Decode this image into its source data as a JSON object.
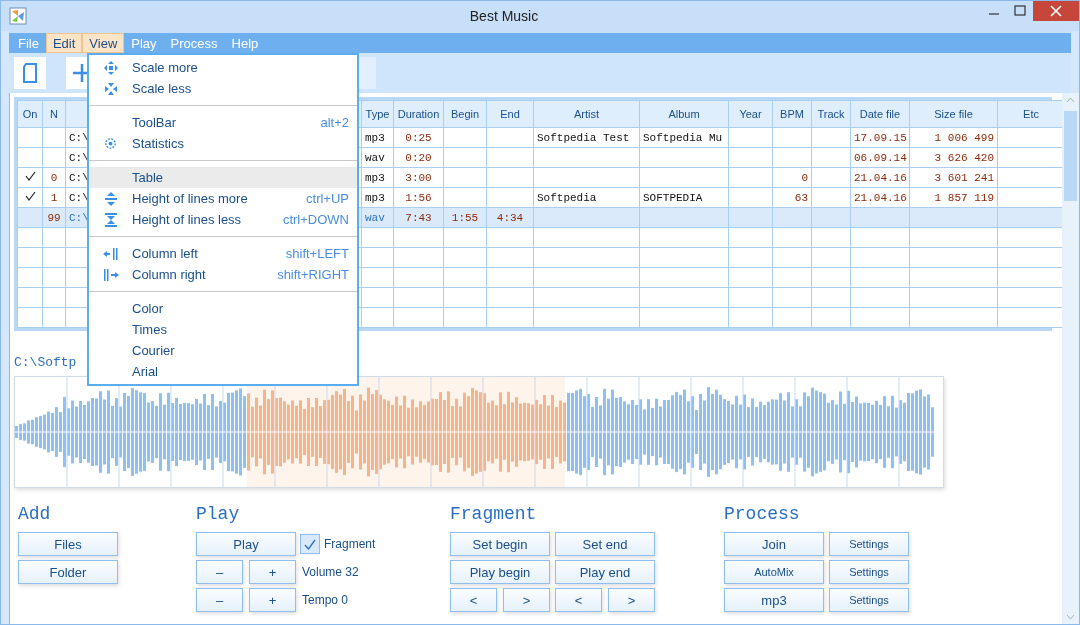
{
  "window": {
    "title": "Best Music"
  },
  "menu_bar": [
    {
      "label": "File",
      "highlighted": false
    },
    {
      "label": "Edit",
      "highlighted": true
    },
    {
      "label": "View",
      "highlighted": true
    },
    {
      "label": "Play",
      "highlighted": false
    },
    {
      "label": "Process",
      "highlighted": false
    },
    {
      "label": "Help",
      "highlighted": false
    }
  ],
  "view_menu": [
    [
      {
        "label": "Scale more",
        "selected": false
      },
      {
        "label": "Scale less",
        "selected": false
      }
    ],
    [
      {
        "label": "ToolBar",
        "shortcut": "alt+2",
        "selected": false
      },
      {
        "label": "Statistics",
        "selected": false
      }
    ],
    [
      {
        "label": "Table",
        "selected": true
      },
      {
        "label": "Height of lines more",
        "shortcut": "ctrl+UP",
        "selected": false
      },
      {
        "label": "Height of lines less",
        "shortcut": "ctrl+DOWN",
        "selected": false
      }
    ],
    [
      {
        "label": "Column left",
        "shortcut": "shift+LEFT",
        "selected": false
      },
      {
        "label": "Column right",
        "shortcut": "shift+RIGHT",
        "selected": false
      }
    ],
    [
      {
        "label": "Color",
        "selected": false
      },
      {
        "label": "Times",
        "selected": false
      },
      {
        "label": "Courier",
        "selected": false
      },
      {
        "label": "Arial",
        "selected": false
      }
    ]
  ],
  "table": {
    "columns": [
      {
        "label": "On"
      },
      {
        "label": "N"
      },
      {},
      {
        "label": "Type"
      },
      {
        "label": "Duration"
      },
      {
        "label": "Begin"
      },
      {
        "label": "End"
      },
      {
        "label": "Artist"
      },
      {
        "label": "Album"
      },
      {
        "label": "Year"
      },
      {
        "label": "BPM"
      },
      {
        "label": "Track"
      },
      {
        "label": "Date file"
      },
      {
        "label": "Size file"
      },
      {
        "label": "Etc"
      }
    ],
    "rows": [
      {
        "on": false,
        "selected": false,
        "path": "C:\\",
        "type": "mp3",
        "duration": "0:25",
        "artist": "Softpedia Test",
        "album": "Softpedia Mu",
        "date": "17.09.15",
        "size": "1 006 499"
      },
      {
        "on": false,
        "selected": false,
        "path": "C:\\",
        "type": "wav",
        "duration": "0:20",
        "date": "06.09.14",
        "size": "3 626 420"
      },
      {
        "on": true,
        "selected": false,
        "n": "0",
        "path": "C:\\",
        "type": "mp3",
        "duration": "3:00",
        "bpm": "0",
        "date": "21.04.16",
        "size": "3 601 241"
      },
      {
        "on": true,
        "selected": false,
        "n": "1",
        "path": "C:\\",
        "type": "mp3",
        "duration": "1:56",
        "artist": "Softpedia",
        "album": "SOFTPEDIA",
        "bpm": "63",
        "date": "21.04.16",
        "size": "1 857 119"
      },
      {
        "on": false,
        "selected": true,
        "n": "99",
        "path": "C:\\",
        "type": "wav",
        "duration": "7:43",
        "begin": "1:55",
        "end": "4:34"
      }
    ]
  },
  "file_path": "C:\\Softp",
  "panels": [
    {
      "title": "Add",
      "buttons": [
        "Files",
        "Folder"
      ]
    },
    {
      "title": "Play",
      "play_button": "Play",
      "fragment": {
        "label": "Fragment",
        "checked": true
      },
      "volume": "Volume 32",
      "tempo": "Tempo 0",
      "minus": "–",
      "plus": "+"
    },
    {
      "title": "Fragment",
      "buttons": [
        "Set begin",
        "Set end",
        "Play begin",
        "Play end",
        "<",
        ">",
        "<",
        ">"
      ]
    },
    {
      "title": "Process",
      "rows": [
        [
          "Join",
          "Settings"
        ],
        [
          "AutoMix",
          "Settings"
        ],
        [
          "mp3",
          "Settings"
        ]
      ]
    }
  ]
}
